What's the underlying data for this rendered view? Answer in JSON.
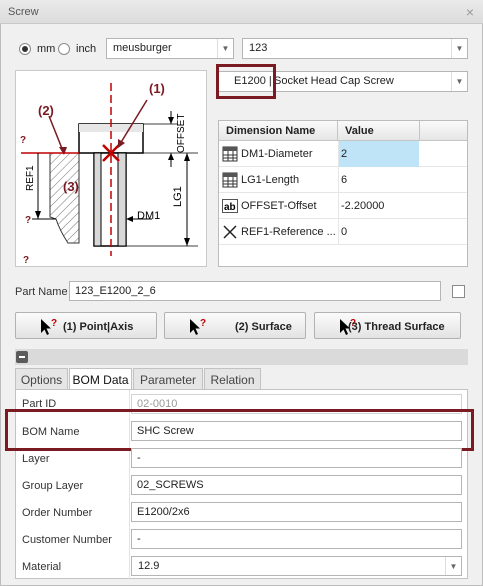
{
  "window": {
    "title": "Screw",
    "close_glyph": "×"
  },
  "units": {
    "mm_label": "mm",
    "inch_label": "inch",
    "selected": "mm"
  },
  "library_select": {
    "value": "meusburger"
  },
  "type_select": {
    "value": "123"
  },
  "part_select": {
    "code": "E1200 |",
    "desc": "Socket Head Cap Screw"
  },
  "diagram": {
    "label_1": "(1)",
    "label_2": "(2)",
    "label_3": "(3)",
    "offset": "OFFSET",
    "ref1": "REF1",
    "lg1": "LG1",
    "dm1": "DM1",
    "q": "?"
  },
  "dimension_table": {
    "col_name": "Dimension Name",
    "col_value": "Value",
    "rows": [
      {
        "icon": "table-icon",
        "name": "DM1-Diameter",
        "value": "2"
      },
      {
        "icon": "table-icon",
        "name": "LG1-Length",
        "value": "6"
      },
      {
        "icon": "ab-text-icon",
        "name": "OFFSET-Offset",
        "value": "-2.20000"
      },
      {
        "icon": "cross-icon",
        "name": "REF1-Reference ...",
        "value": "0"
      }
    ]
  },
  "part_name": {
    "label": "Part Name",
    "value": "123_E1200_2_6"
  },
  "buttons": {
    "point_axis": "(1) Point|Axis",
    "surface": "(2) Surface",
    "thread_surface": "(3) Thread Surface"
  },
  "tabs": [
    "Options",
    "BOM Data",
    "Parameter",
    "Relation"
  ],
  "active_tab": "BOM Data",
  "bom": {
    "part_id": {
      "label": "Part ID",
      "value": "02-0010"
    },
    "bom_name": {
      "label": "BOM Name",
      "value": "SHC Screw"
    },
    "layer": {
      "label": "Layer",
      "value": "-"
    },
    "group_layer": {
      "label": "Group Layer",
      "value": "02_SCREWS"
    },
    "order_number": {
      "label": "Order Number",
      "value": "E1200/2x6"
    },
    "customer_number": {
      "label": "Customer Number",
      "value": "-"
    },
    "material": {
      "label": "Material",
      "value": "12.9"
    }
  },
  "colors": {
    "highlight": "#7a1a22",
    "diagram_red": "#c00000",
    "selected_cell": "#bfe3f7"
  }
}
